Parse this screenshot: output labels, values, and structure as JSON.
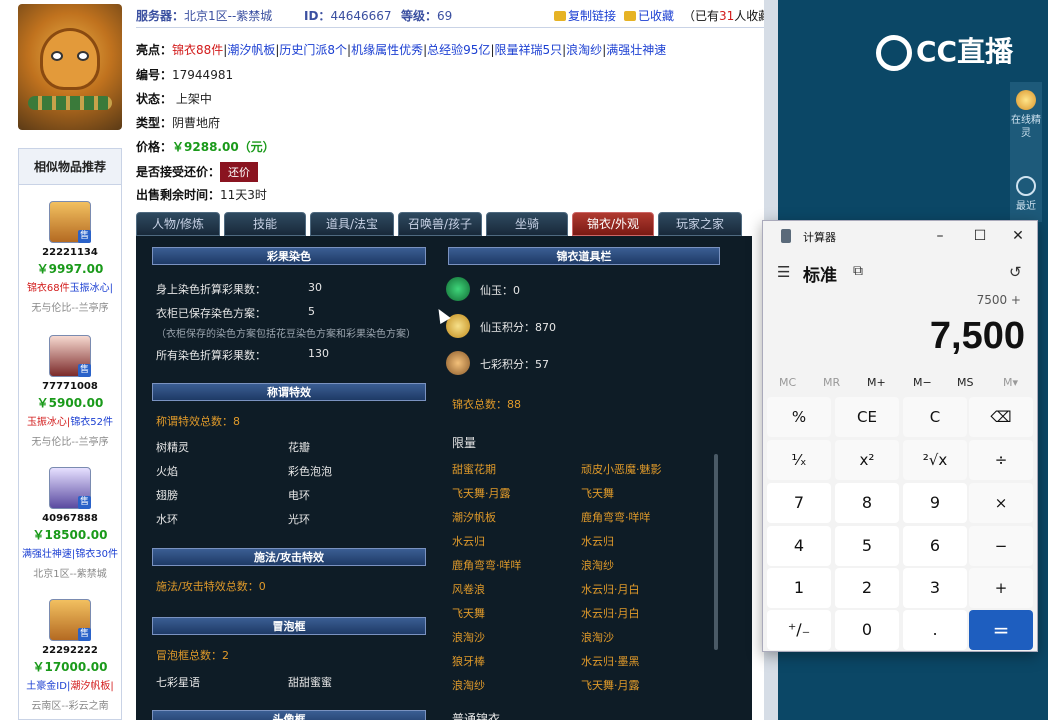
{
  "info": {
    "server_label": "服务器：",
    "server": "北京1区--紫禁城",
    "id_label": "ID：",
    "id": "44646667",
    "level_label": "等级：",
    "level": "69",
    "copy_link": "复制链接",
    "favorited": "已收藏",
    "fav_count_prefix": "（已有",
    "fav_count": "31",
    "fav_count_suffix": "人收藏）"
  },
  "highlights": {
    "label": "亮点：",
    "items": [
      "锦衣88件",
      "潮汐帆板",
      "历史门派8个",
      "机缘属性优秀",
      "总经验95亿",
      "限量祥瑞5只",
      "浪淘纱",
      "满强壮神速"
    ]
  },
  "details": {
    "code_label": "编号：",
    "code": "17944981",
    "status_label": "状态：",
    "status": "上架中",
    "type_label": "类型：",
    "type": "阴曹地府",
    "price_label": "价格：",
    "price": "￥9288.00（元）",
    "counter_label": "是否接受还价：",
    "counter_button": "还价",
    "remain_label": "出售剩余时间：",
    "remain": "11天3时"
  },
  "similar": {
    "title": "相似物品推荐",
    "items": [
      {
        "id": "22221134",
        "price": "￥9997.00",
        "tag1": "锦衣68件",
        "tag2": "玉振冰心|",
        "server": "无与伦比--兰亭序",
        "sale": "售"
      },
      {
        "id": "77771008",
        "price": "￥5900.00",
        "tag1": "玉振冰心|",
        "tag2": "锦衣52件",
        "server": "无与伦比--兰亭序",
        "sale": "售"
      },
      {
        "id": "40967888",
        "price": "￥18500.00",
        "tag1": "满强壮神速|",
        "tag2": "锦衣30件",
        "server": "北京1区--紫禁城",
        "sale": "售"
      },
      {
        "id": "22292222",
        "price": "￥17000.00",
        "tag1": "土豪金ID|",
        "tag2": "潮汐帆板|",
        "server": "云南区--彩云之南",
        "sale": "售"
      }
    ]
  },
  "tabs": [
    "人物/修炼",
    "技能",
    "道具/法宝",
    "召唤兽/孩子",
    "坐骑",
    "锦衣/外观",
    "玩家之家"
  ],
  "panel": {
    "dye_head": "彩果染色",
    "dye_rows": [
      {
        "label": "身上染色折算彩果数：",
        "value": "30"
      },
      {
        "label": "衣柜已保存染色方案：",
        "value": "5"
      }
    ],
    "dye_note": "（衣柜保存的染色方案包括花豆染色方案和彩果染色方案）",
    "dye_total_label": "所有染色折算彩果数：",
    "dye_total": "130",
    "title_head": "称谓特效",
    "title_count": "称谓特效总数：8",
    "title_items": [
      "树精灵",
      "花瓣",
      "火焰",
      "彩色泡泡",
      "翅膀",
      "电环",
      "水环",
      "光环"
    ],
    "spell_head": "施法/攻击特效",
    "spell_count": "施法/攻击特效总数：0",
    "bubble_head": "冒泡框",
    "bubble_count": "冒泡框总数：2",
    "bubble_items": [
      "七彩星语",
      "甜甜蜜蜜"
    ],
    "next_head": "头像框",
    "wardrobe_head": "锦衣道具栏",
    "currency": [
      {
        "label": "仙玉：0"
      },
      {
        "label": "仙玉积分：870"
      },
      {
        "label": "七彩积分：57"
      }
    ],
    "wardrobe_total": "锦衣总数：88",
    "limited_title": "限量",
    "limited_items": [
      "甜蜜花期",
      "顽皮小恶魔·魅影",
      "飞天舞·月露",
      "飞天舞",
      "潮汐帆板",
      "鹿角弯弯·咩咩",
      "水云归",
      "水云归",
      "鹿角弯弯·咩咩",
      "浪淘纱",
      "风卷浪",
      "水云归·月白",
      "飞天舞",
      "水云归·月白",
      "浪淘沙",
      "浪淘沙",
      "狼牙棒",
      "水云归·墨黑",
      "浪淘纱",
      "飞天舞·月露"
    ],
    "normal_title": "普通锦衣"
  },
  "stream": {
    "logo": "CC直播",
    "online": "在线精灵",
    "recent": "最近"
  },
  "calculator": {
    "title": "计算器",
    "mode": "标准",
    "expression": "7500 +",
    "display": "7,500",
    "memory": [
      "MC",
      "MR",
      "M+",
      "M−",
      "MS",
      "M▾"
    ],
    "keys": [
      [
        "%",
        "CE",
        "C",
        "⌫"
      ],
      [
        "¹⁄ₓ",
        "x²",
        "²√x",
        "÷"
      ],
      [
        "7",
        "8",
        "9",
        "×"
      ],
      [
        "4",
        "5",
        "6",
        "−"
      ],
      [
        "1",
        "2",
        "3",
        "+"
      ],
      [
        "⁺∕₋",
        "0",
        ".",
        "="
      ]
    ]
  },
  "colors": {
    "panel_bg": "#0e1c26",
    "accent_orange": "#e09a2a",
    "price_green": "#1a9a1a",
    "highlight_red": "#d21b1b",
    "stream_bg": "#0b4766",
    "calc_equals": "#1e5ebf"
  }
}
